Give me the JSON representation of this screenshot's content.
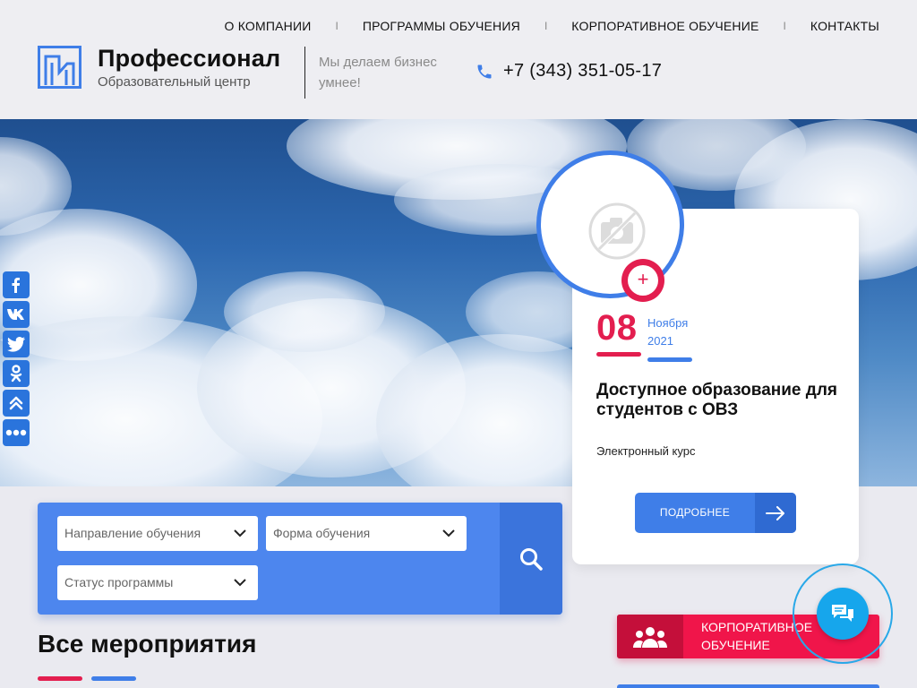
{
  "nav": {
    "items": [
      "О КОМПАНИИ",
      "ПРОГРАММЫ ОБУЧЕНИЯ",
      "КОРПОРАТИВНОЕ ОБУЧЕНИЕ",
      "КОНТАКТЫ"
    ],
    "separator": "I"
  },
  "brand": {
    "name": "Профессионал",
    "subtitle": "Образовательный центр",
    "tagline": "Мы делаем бизнес умнее!"
  },
  "contact": {
    "phone": "+7 (343) 351-05-17",
    "icon": "phone-icon"
  },
  "social": {
    "icons": [
      "facebook-icon",
      "vk-icon",
      "twitter-icon",
      "odnoklassniki-icon",
      "share-up-icon",
      "more-icon"
    ]
  },
  "event": {
    "photo_icon": "no-photo-icon",
    "add": "+",
    "day": "08",
    "month": "Ноября",
    "year": "2021",
    "title": "Доступное образование для студентов с ОВЗ",
    "type": "Электронный курс",
    "button": "ПОДРОБНЕЕ"
  },
  "filter": {
    "direction_placeholder": "Направление обучения",
    "form_placeholder": "Форма обучения",
    "status_placeholder": "Статус программы"
  },
  "section": {
    "title": "Все мероприятия"
  },
  "corporate": {
    "line1": "КОРПОРАТИВНОЕ",
    "line2": "ОБУЧЕНИЕ"
  },
  "colors": {
    "accent_blue": "#3f7ee8",
    "accent_red": "#e31e4f",
    "chat": "#16a6ec"
  }
}
